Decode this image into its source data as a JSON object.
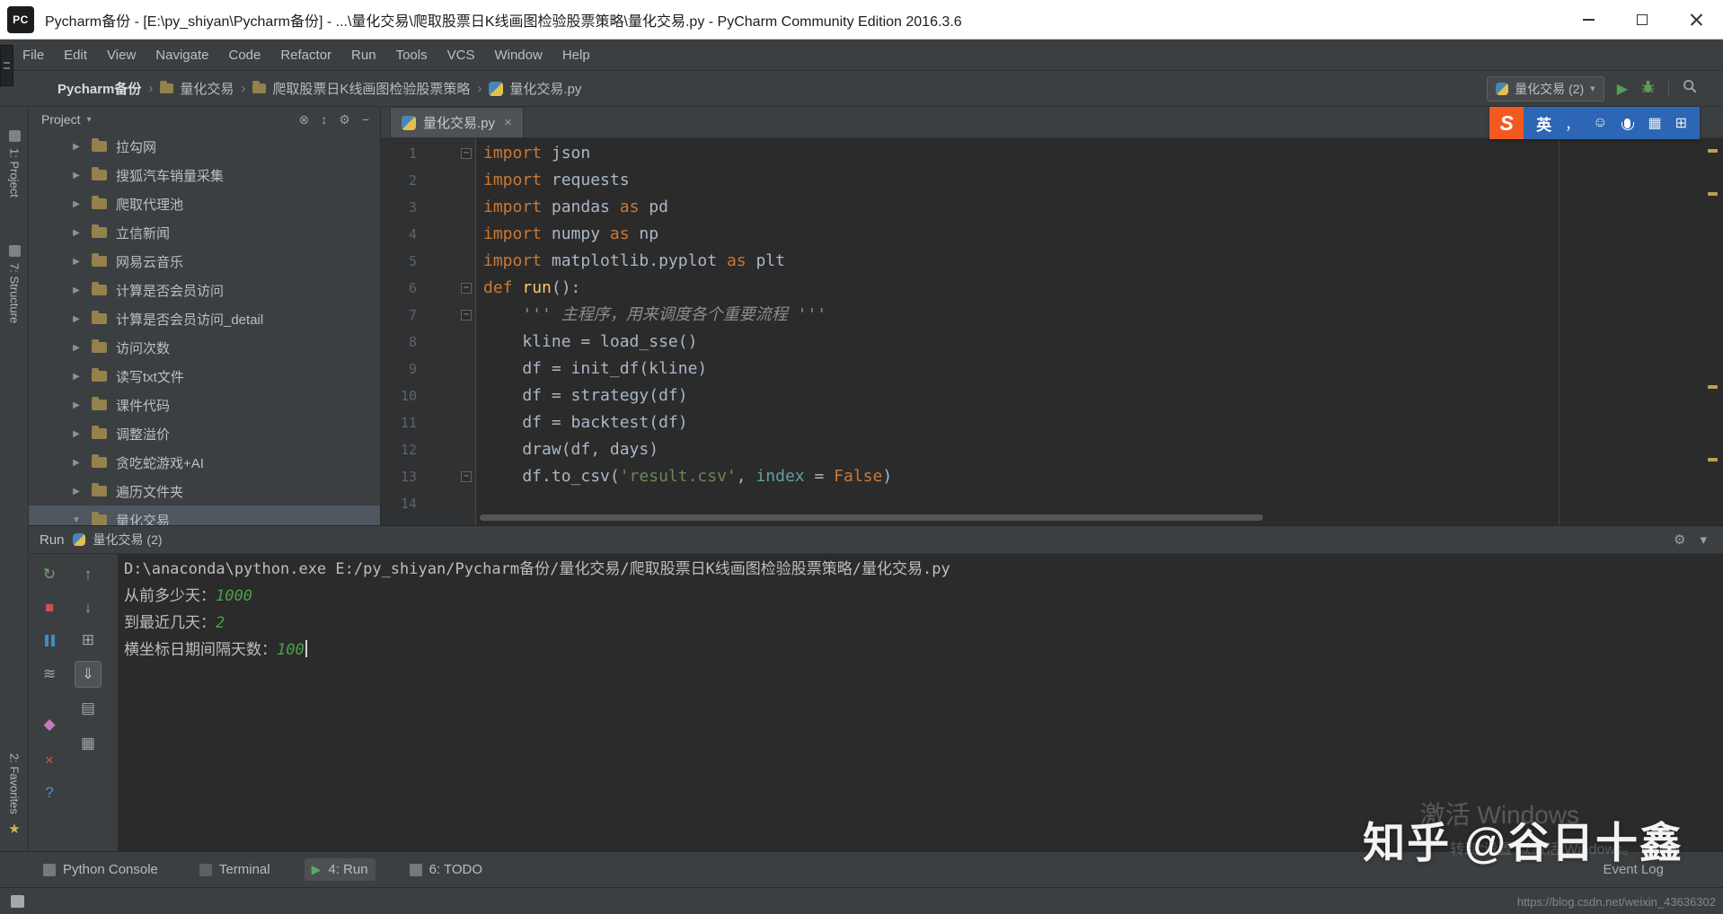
{
  "titlebar": {
    "icon_text": "PC",
    "title": "Pycharm备份 - [E:\\py_shiyan\\Pycharm备份] - ...\\量化交易\\爬取股票日K线画图检验股票策略\\量化交易.py - PyCharm Community Edition 2016.3.6"
  },
  "menubar": [
    "File",
    "Edit",
    "View",
    "Navigate",
    "Code",
    "Refactor",
    "Run",
    "Tools",
    "VCS",
    "Window",
    "Help"
  ],
  "navbar": {
    "separator": "›",
    "chevron": "▾",
    "run_glyph": "▶",
    "run_config": "量化交易 (2)",
    "crumbs": [
      {
        "label": "Pycharm备份",
        "icon": "none",
        "bold": true
      },
      {
        "label": "量化交易",
        "icon": "folder"
      },
      {
        "label": "爬取股票日K线画图检验股票策略",
        "icon": "folder"
      },
      {
        "label": "量化交易.py",
        "icon": "python"
      }
    ]
  },
  "ime": {
    "logo": "S",
    "lang": "英",
    "icons": [
      {
        "name": "punctuation-icon",
        "glyph": "，"
      },
      {
        "name": "smiley-icon",
        "glyph": "☺"
      },
      {
        "name": "mic-icon",
        "glyph": ""
      },
      {
        "name": "keyboard-icon",
        "glyph": "▦"
      },
      {
        "name": "toolbox-icon",
        "glyph": "⊞"
      }
    ]
  },
  "stripes": {
    "top": [
      "1: Project",
      "7: Structure"
    ],
    "bottom": [
      "2: Favorites"
    ],
    "star": "★"
  },
  "project": {
    "header": "Project",
    "chevron": "▾",
    "arrow_collapsed": "▶",
    "arrow_expanded": "▼",
    "header_icons": [
      {
        "name": "collapse-all-icon",
        "glyph": "⊗"
      },
      {
        "name": "scroll-from-source-icon",
        "glyph": "↕"
      },
      {
        "name": "settings-icon",
        "glyph": "⚙"
      },
      {
        "name": "hide-panel-icon",
        "glyph": "−"
      }
    ],
    "tree": [
      {
        "label": "拉勾网"
      },
      {
        "label": "搜狐汽车销量采集"
      },
      {
        "label": "爬取代理池"
      },
      {
        "label": "立信新闻"
      },
      {
        "label": "网易云音乐"
      },
      {
        "label": "计算是否会员访问"
      },
      {
        "label": "计算是否会员访问_detail"
      },
      {
        "label": "访问次数"
      },
      {
        "label": "读写txt文件"
      },
      {
        "label": "课件代码"
      },
      {
        "label": "调整溢价"
      },
      {
        "label": "贪吃蛇游戏+AI"
      },
      {
        "label": "遍历文件夹"
      },
      {
        "label": "量化交易",
        "expanded": true,
        "selected": true
      }
    ]
  },
  "editor": {
    "tab": "量化交易.py",
    "close_glyph": "×",
    "fold_glyph": "−",
    "code": [
      {
        "n": "1",
        "fold": true,
        "tokens": [
          [
            "kw",
            "import"
          ],
          [
            "pl",
            " json"
          ]
        ]
      },
      {
        "n": "2",
        "tokens": [
          [
            "kw",
            "import"
          ],
          [
            "pl",
            " requests"
          ]
        ]
      },
      {
        "n": "3",
        "tokens": [
          [
            "kw",
            "import"
          ],
          [
            "pl",
            " pandas "
          ],
          [
            "kw",
            "as"
          ],
          [
            "pl",
            " pd"
          ]
        ]
      },
      {
        "n": "4",
        "tokens": [
          [
            "kw",
            "import"
          ],
          [
            "pl",
            " numpy "
          ],
          [
            "kw",
            "as"
          ],
          [
            "pl",
            " np"
          ]
        ]
      },
      {
        "n": "5",
        "tokens": [
          [
            "kw",
            "import"
          ],
          [
            "pl",
            " matplotlib.pyplot "
          ],
          [
            "kw",
            "as"
          ],
          [
            "pl",
            " plt"
          ]
        ]
      },
      {
        "n": "6",
        "fold": true,
        "tokens": [
          [
            "kw",
            "def"
          ],
          [
            "pl",
            " "
          ],
          [
            "fn",
            "run"
          ],
          [
            "pl",
            "():"
          ]
        ]
      },
      {
        "n": "7",
        "fold": true,
        "tokens": [
          [
            "doc",
            "    ''' 主程序，用来调度各个重要流程 '''"
          ]
        ]
      },
      {
        "n": "8",
        "tokens": [
          [
            "pl",
            "    kline = load_sse()"
          ]
        ]
      },
      {
        "n": "9",
        "tokens": [
          [
            "pl",
            "    df = init_df(kline)"
          ]
        ]
      },
      {
        "n": "10",
        "tokens": [
          [
            "pl",
            "    df = strategy(df)"
          ]
        ]
      },
      {
        "n": "11",
        "tokens": [
          [
            "pl",
            "    df = backtest(df)"
          ]
        ]
      },
      {
        "n": "12",
        "tokens": [
          [
            "pl",
            "    draw(df, days)"
          ]
        ]
      },
      {
        "n": "13",
        "fold": true,
        "tokens": [
          [
            "pl",
            "    df.to_csv("
          ],
          [
            "str",
            "'result.csv'"
          ],
          [
            "pl",
            ", "
          ],
          [
            "kwarg",
            "index"
          ],
          [
            "pl",
            " = "
          ],
          [
            "kw",
            "False"
          ],
          [
            "pl",
            ")"
          ]
        ]
      },
      {
        "n": "14",
        "tokens": []
      }
    ]
  },
  "run_panel": {
    "title": "Run",
    "config": "量化交易 (2)",
    "header_icons": [
      {
        "name": "settings-icon",
        "glyph": "⚙"
      },
      {
        "name": "hide-panel-icon",
        "glyph": "▾"
      }
    ],
    "toolbar": {
      "col1": [
        {
          "name": "rerun-button",
          "glyph": "↻",
          "color": "#67a867"
        },
        {
          "name": "stop-button",
          "glyph": "■",
          "color": "#c75450"
        },
        {
          "name": "pause-button",
          "glyph": "pause",
          "color": "#3a8fc6"
        },
        {
          "name": "soft-wrap-button",
          "glyph": "≋",
          "color": "#9fa3a6"
        },
        {
          "name": "pin-button",
          "glyph": "◆",
          "color": "#c57bbb"
        },
        {
          "name": "close-button",
          "glyph": "×",
          "color": "#c75450"
        },
        {
          "name": "help-button",
          "glyph": "?",
          "color": "#4a8fd4"
        }
      ],
      "col2": [
        {
          "name": "up-stack-button",
          "glyph": "↑",
          "color": "#9fa3a6"
        },
        {
          "name": "down-stack-button",
          "glyph": "↓",
          "color": "#9fa3a6"
        },
        {
          "name": "restore-layout-button",
          "glyph": "⊞",
          "color": "#9fa3a6"
        },
        {
          "name": "scroll-to-end-button",
          "glyph": "⇓",
          "color": "#b9bcbe",
          "selected": true
        },
        {
          "name": "print-button",
          "glyph": "▤",
          "color": "#9fa3a6"
        },
        {
          "name": "clear-all-button",
          "glyph": "▦",
          "color": "#9fa3a6"
        }
      ]
    },
    "console": [
      {
        "out": "D:\\anaconda\\python.exe E:/py_shiyan/Pycharm备份/量化交易/爬取股票日K线画图检验股票策略/量化交易.py"
      },
      {
        "out": "从前多少天：",
        "input": "1000"
      },
      {
        "out": "到最近几天：",
        "input": "2"
      },
      {
        "out": "横坐标日期间隔天数：",
        "input": "100",
        "cursor": true
      }
    ]
  },
  "toolwindow_bar": {
    "run_glyph": "▶",
    "left": [
      {
        "label": "Python Console",
        "icon": "console"
      },
      {
        "label": "Terminal",
        "icon": "terminal"
      },
      {
        "label": "4: Run",
        "icon": "run",
        "active": true
      },
      {
        "label": "6: TODO",
        "icon": "todo"
      }
    ],
    "right": "Event Log"
  },
  "watermarks": {
    "zhihu": "知乎 @谷日十鑫",
    "activate_title": "激活 Windows",
    "activate_sub": "转到“设置”以激活 Windows。",
    "url": "https://blog.csdn.net/weixin_43636302"
  }
}
